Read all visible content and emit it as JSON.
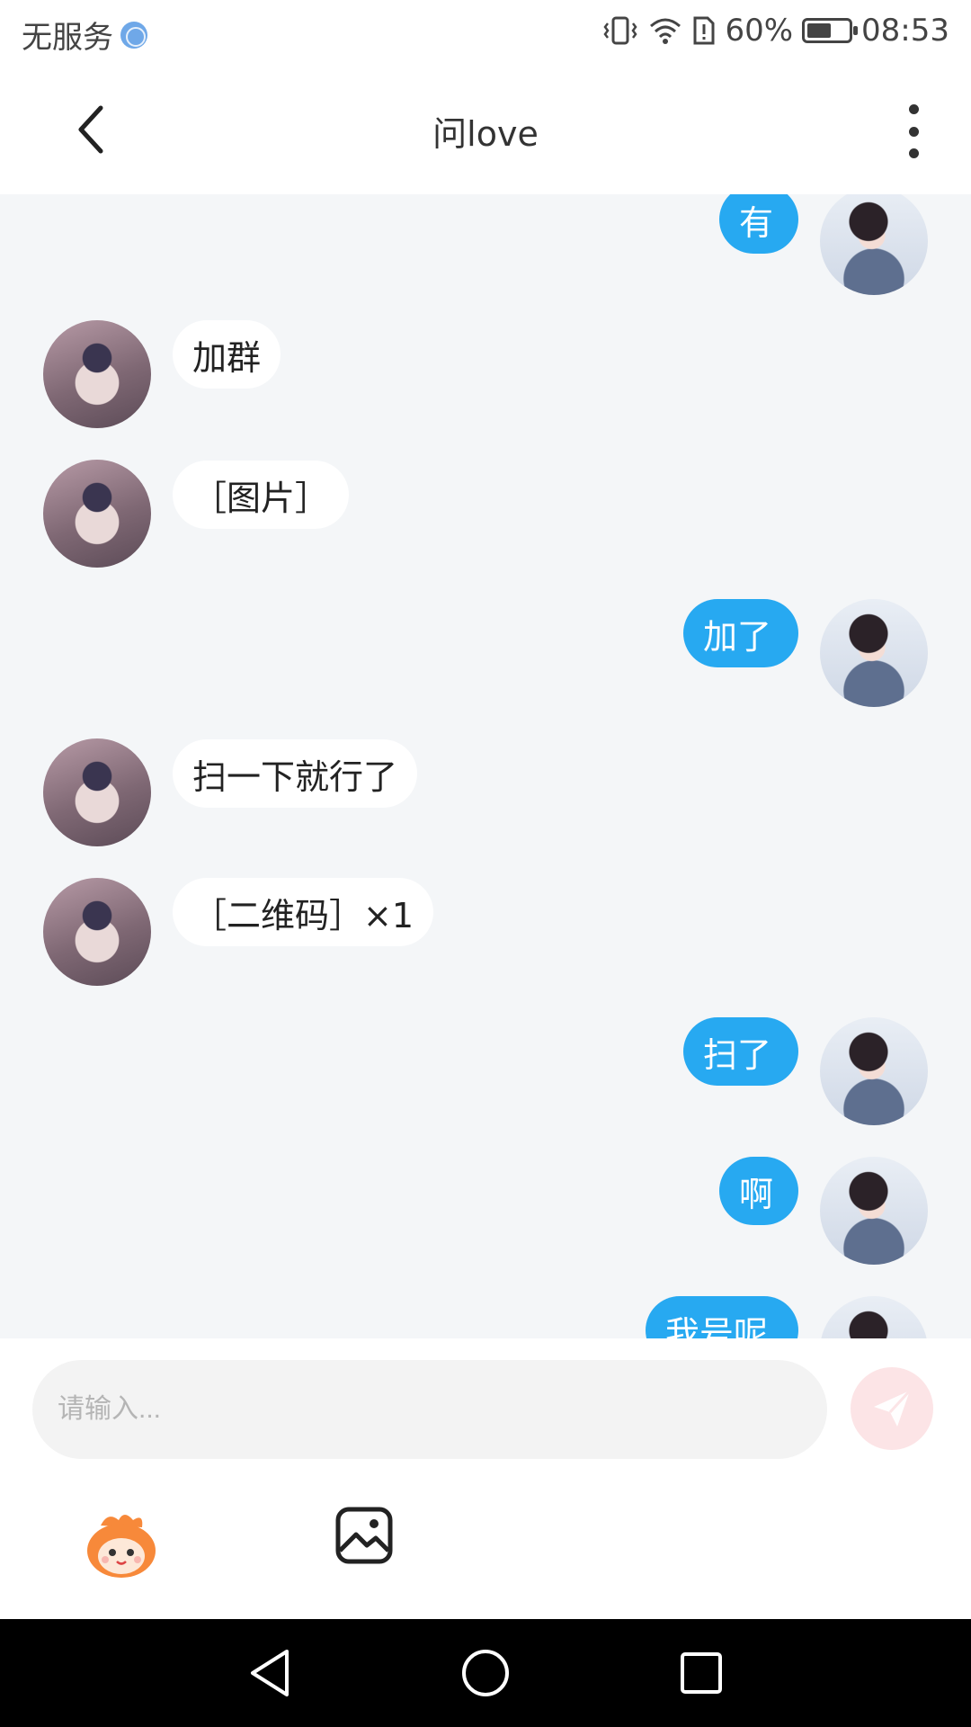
{
  "status": {
    "carrier": "无服务",
    "battery": "60%",
    "battery_level": 0.6,
    "time": "08:53"
  },
  "header": {
    "title": "问love"
  },
  "messages": [
    {
      "side": "right",
      "text": "有"
    },
    {
      "side": "left",
      "text": "加群"
    },
    {
      "side": "left",
      "text": "［图片］"
    },
    {
      "side": "right",
      "text": "加了"
    },
    {
      "side": "left",
      "text": "扫一下就行了"
    },
    {
      "side": "left",
      "text": "［二维码］×1"
    },
    {
      "side": "right",
      "text": "扫了"
    },
    {
      "side": "right",
      "text": "啊"
    },
    {
      "side": "right",
      "text": "我号呢"
    }
  ],
  "input": {
    "placeholder": "请输入..."
  },
  "icons": {
    "back": "chevron-left-icon",
    "more": "more-vertical-icon",
    "send": "paper-plane-icon",
    "emoji": "mascot-emoji-icon",
    "image": "image-icon"
  },
  "colors": {
    "accent": "#27a9f1",
    "chat_bg": "#f4f6f8",
    "send_disabled": "#fce4e6"
  }
}
